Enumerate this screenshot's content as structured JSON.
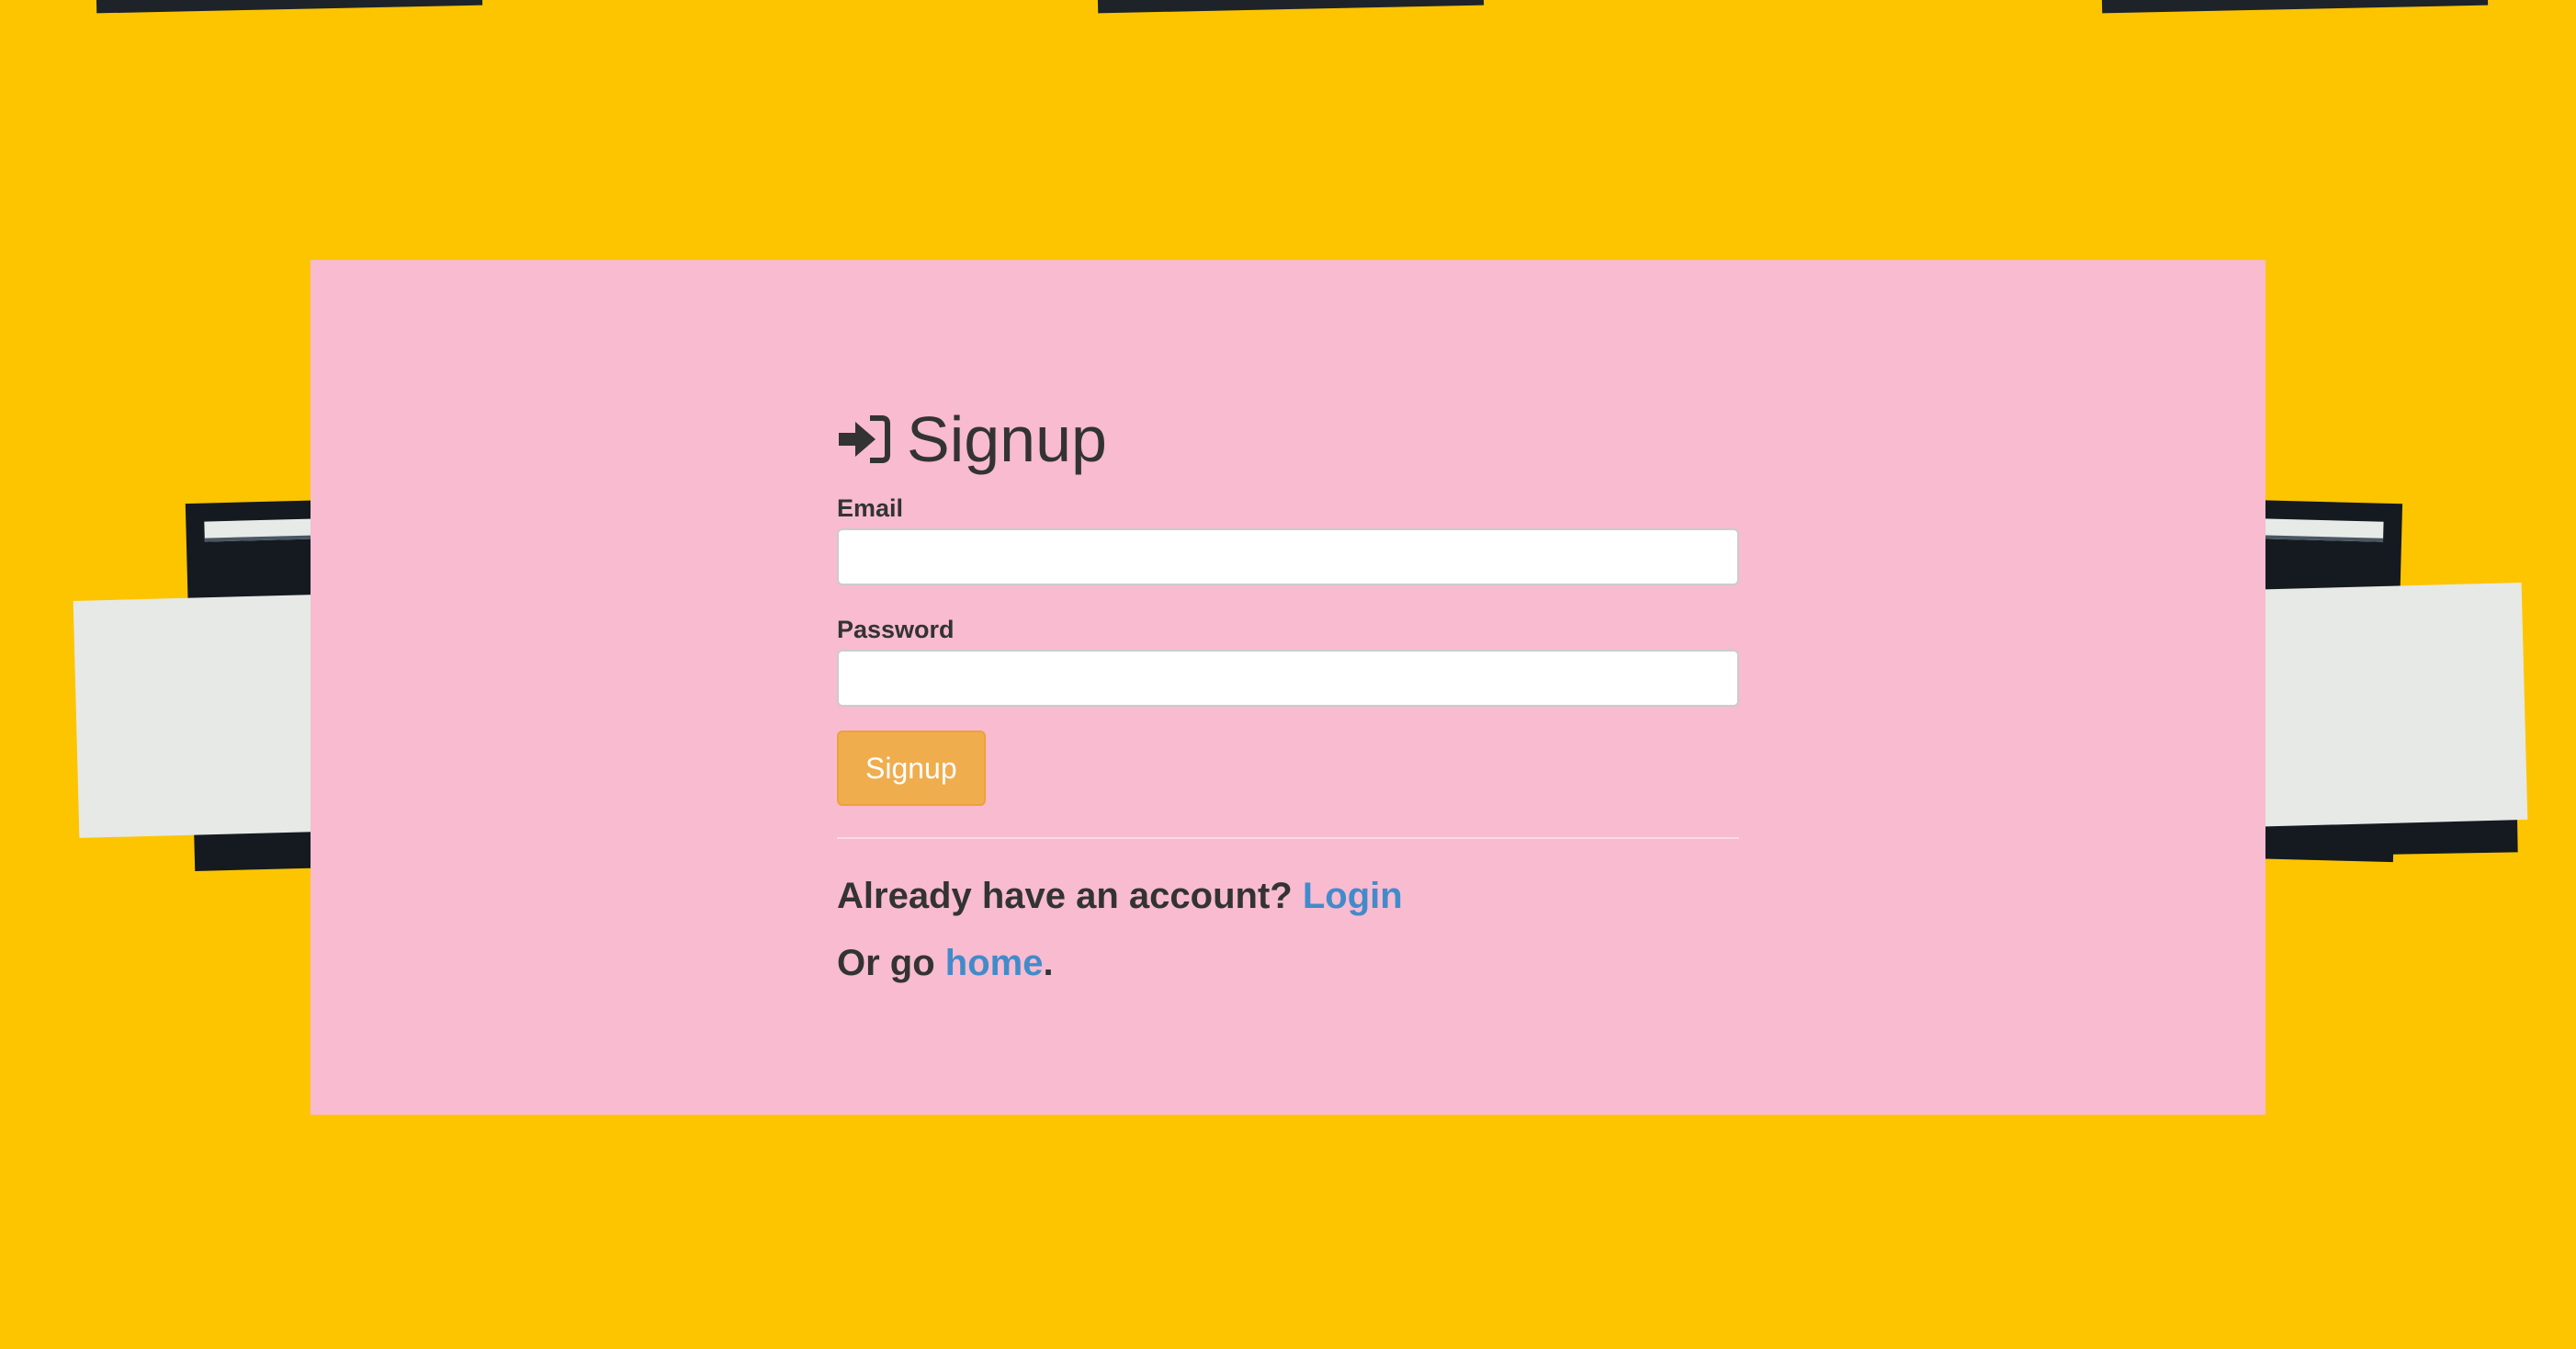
{
  "signup": {
    "title": "Signup",
    "icon": "sign-in-icon",
    "email_label": "Email",
    "email_value": "",
    "password_label": "Password",
    "password_value": "",
    "submit_label": "Signup"
  },
  "footer": {
    "login_prompt": "Already have an account?",
    "login_link": "Login",
    "home_prefix": "Or go",
    "home_link": "home",
    "home_suffix": "."
  },
  "colors": {
    "background": "#fdc500",
    "card": "#f8bbd0",
    "button": "#f0ad4e",
    "link": "#428bca",
    "text": "#333333"
  }
}
